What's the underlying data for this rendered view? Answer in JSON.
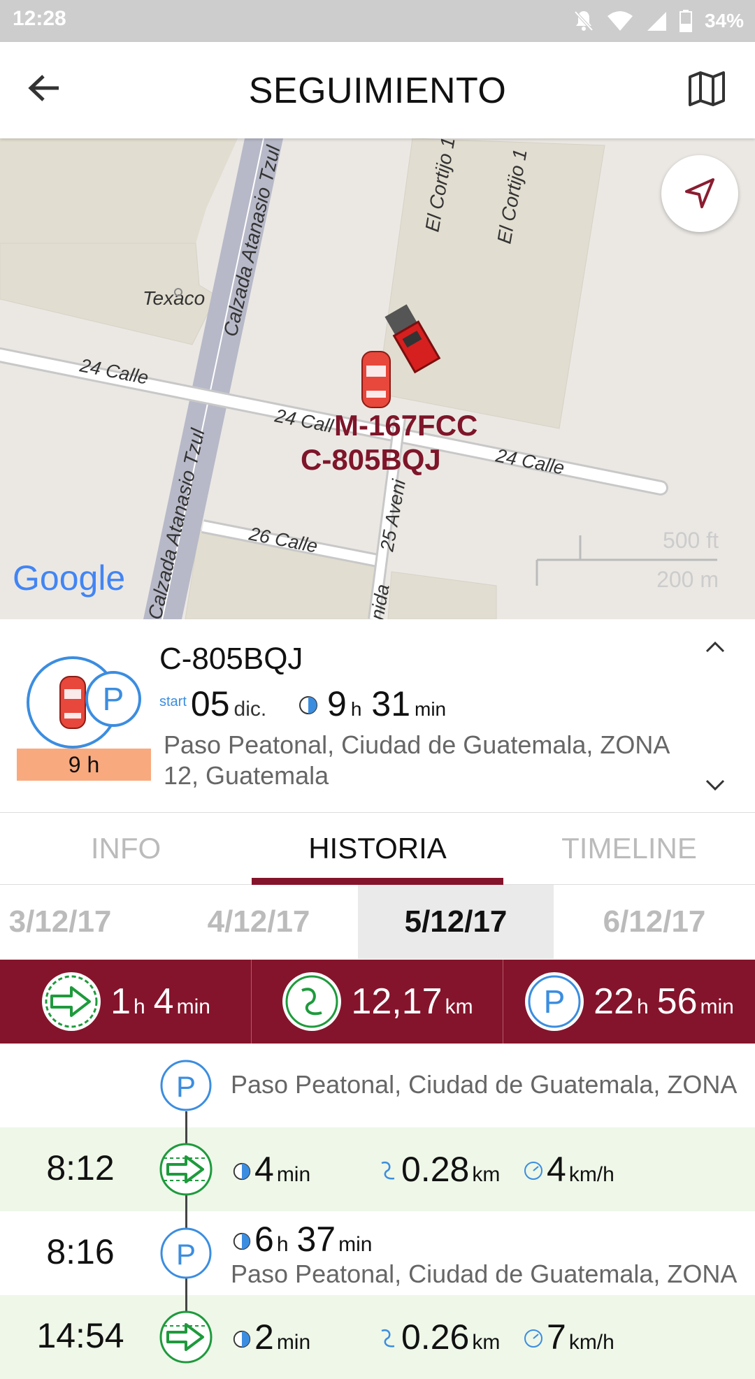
{
  "status_bar": {
    "time": "12:28",
    "battery": "34%"
  },
  "header": {
    "title": "SEGUIMIENTO"
  },
  "map": {
    "labels": {
      "texaco": "Texaco",
      "calzada_top": "Calzada Atanasio Tzul",
      "calzada_bottom": "Calzada Atanasio Tzul",
      "cortijo_a": "El Cortijo 1",
      "cortijo_b": "El Cortijo 1",
      "calle24_a": "24 Calle",
      "calle24_b": "24 Call",
      "calle24_c": "24 Calle",
      "calle26": "26 Calle",
      "avenida_a": "25 Aveni",
      "avenida_b": "nida",
      "google": "Google",
      "scale_ft": "500 ft",
      "scale_m": "200 m"
    },
    "plates": {
      "truck": "M-167FCC",
      "car": "C-805BQJ"
    }
  },
  "vehicle": {
    "plate": "C-805BQJ",
    "parked_duration_badge": "9 h",
    "start_label": "start",
    "start_day": "05",
    "start_month": "dic.",
    "elapsed_h": "9",
    "elapsed_h_unit": "h",
    "elapsed_min": "31",
    "elapsed_min_unit": "min",
    "address_line1": "Paso Peatonal, Ciudad de Guatemala, ZONA",
    "address_line2": "12, Guatemala"
  },
  "tabs": [
    {
      "label": "INFO"
    },
    {
      "label": "HISTORIA"
    },
    {
      "label": "TIMELINE"
    }
  ],
  "dates": [
    "3/12/17",
    "4/12/17",
    "5/12/17",
    "6/12/17"
  ],
  "summary": {
    "driving": {
      "h": "1",
      "h_unit": "h",
      "min": "4",
      "min_unit": "min"
    },
    "distance": {
      "value": "12,17",
      "unit": "km"
    },
    "parked": {
      "h": "22",
      "h_unit": "h",
      "min": "56",
      "min_unit": "min"
    }
  },
  "timeline": [
    {
      "type": "parked",
      "time": "",
      "address": "Paso Peatonal, Ciudad de Guatemala, ZONA"
    },
    {
      "type": "driving",
      "time": "8:12",
      "duration": "4",
      "duration_unit": "min",
      "distance": "0.28",
      "distance_unit": "km",
      "speed": "4",
      "speed_unit": "km/h"
    },
    {
      "type": "parked",
      "time": "8:16",
      "h": "6",
      "h_unit": "h",
      "min": "37",
      "min_unit": "min",
      "address": "Paso Peatonal, Ciudad de Guatemala, ZONA"
    },
    {
      "type": "driving",
      "time": "14:54",
      "duration": "2",
      "duration_unit": "min",
      "distance": "0.26",
      "distance_unit": "km",
      "speed": "7",
      "speed_unit": "km/h"
    }
  ],
  "colors": {
    "brand": "#84142b",
    "parking_blue": "#3b8de0",
    "driving_green": "#1e9a3c",
    "badge": "#f9a97e"
  }
}
